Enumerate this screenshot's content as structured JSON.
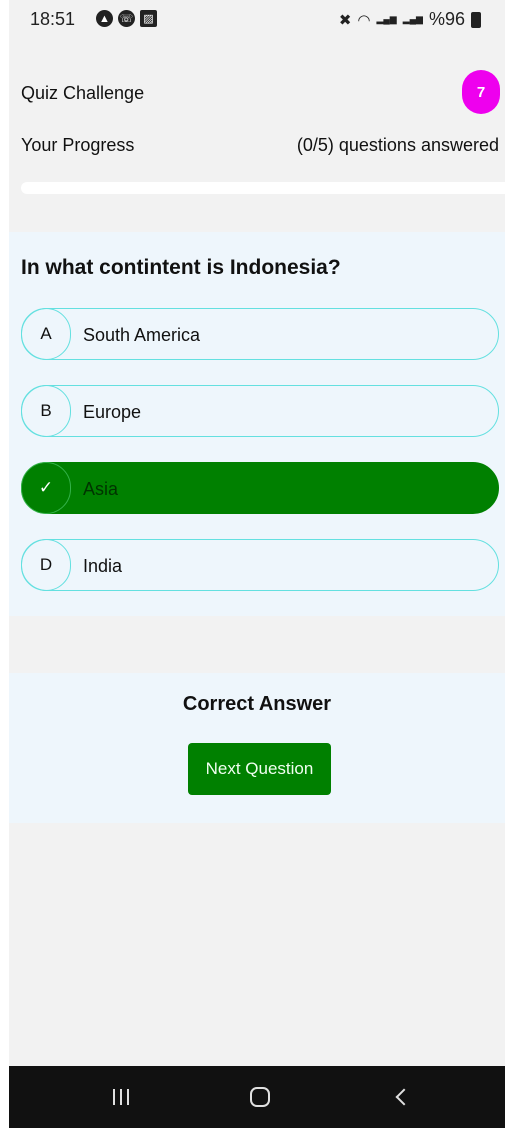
{
  "status_bar": {
    "time": "18:51",
    "battery": "%96",
    "icons": [
      "alert-icon",
      "whatsapp-icon",
      "gallery-icon",
      "mute-icon",
      "wifi-icon",
      "signal-lte1-icon",
      "signal-lte2-icon",
      "battery-icon"
    ]
  },
  "header": {
    "title": "Quiz Challenge",
    "score": "7",
    "progress_label": "Your Progress",
    "progress_count": "(0/5) questions answered",
    "progress_fraction": 0
  },
  "question": {
    "text": "In what contintent is Indonesia?",
    "options": [
      {
        "letter": "A",
        "label": "South America",
        "selected": false
      },
      {
        "letter": "B",
        "label": "Europe",
        "selected": false
      },
      {
        "letter": "✓",
        "label": "Asia",
        "selected": true
      },
      {
        "letter": "D",
        "label": "India",
        "selected": false
      }
    ]
  },
  "result": {
    "title": "Correct Answer",
    "next_label": "Next Question"
  },
  "nav": {
    "icons": [
      "recents-icon",
      "home-icon",
      "back-icon"
    ]
  },
  "colors": {
    "accent_green": "#008000",
    "badge_magenta": "#ee00ee",
    "option_border": "#64e0e0",
    "card_bg": "#eef6fc"
  }
}
